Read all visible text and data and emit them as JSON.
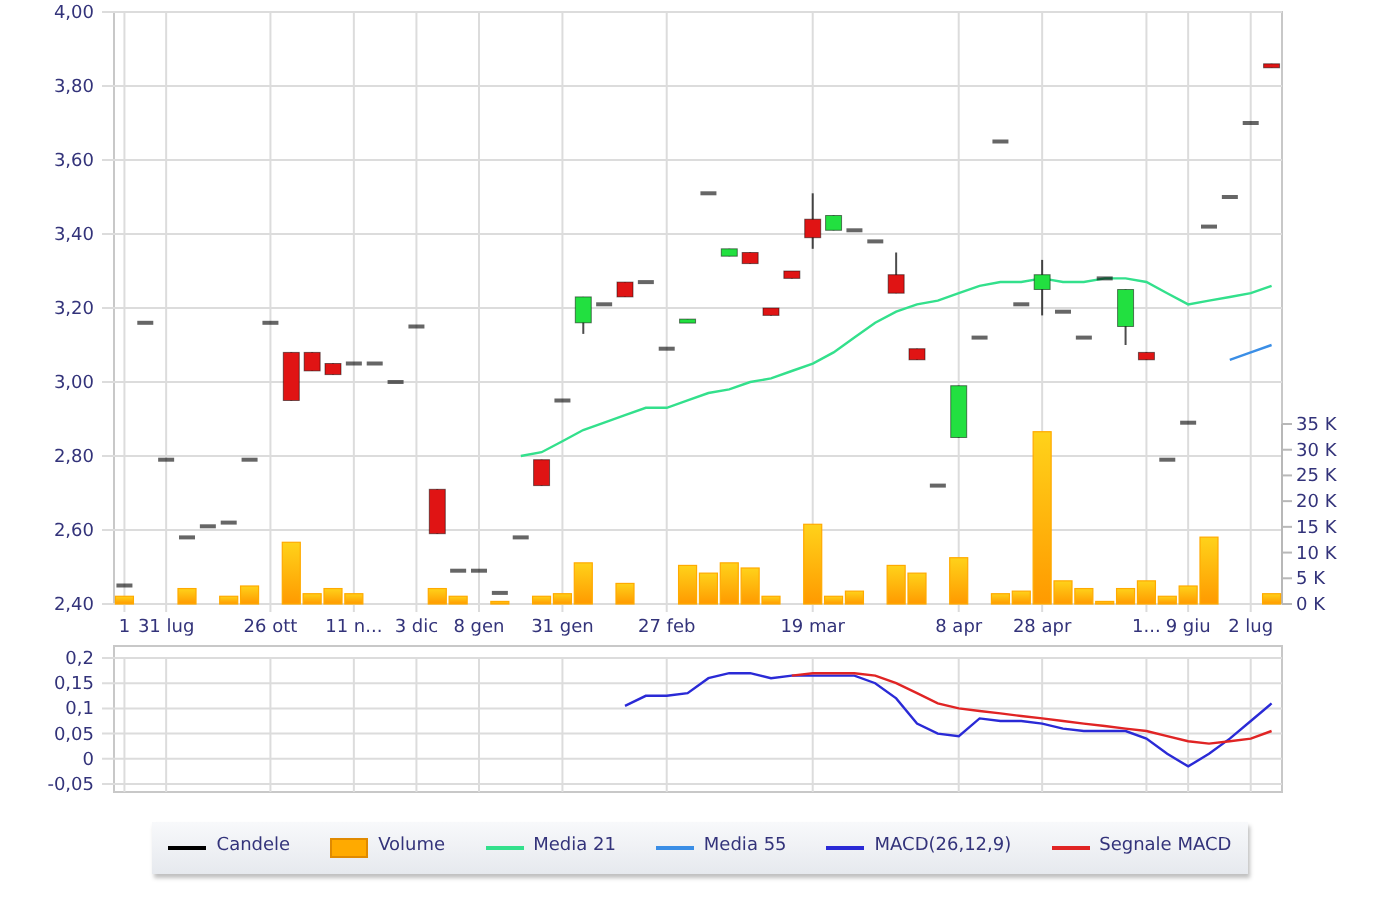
{
  "price_chart": {
    "chart_data": {
      "type": "bar",
      "grid": true,
      "ylim": [
        2.4,
        4.0
      ],
      "y2lim": [
        0,
        35
      ],
      "categories": [
        "1",
        null,
        "31 lug",
        null,
        null,
        null,
        null,
        "26 ott",
        null,
        null,
        null,
        "11 n...",
        null,
        null,
        "3 dic",
        null,
        null,
        "8 gen",
        null,
        null,
        null,
        "31 gen",
        null,
        null,
        null,
        null,
        "27 feb",
        null,
        null,
        null,
        null,
        null,
        null,
        "19 mar",
        null,
        null,
        null,
        null,
        null,
        null,
        "8 apr",
        null,
        null,
        null,
        "28 apr",
        null,
        null,
        null,
        null,
        "1...",
        null,
        "9 giu",
        null,
        null,
        "2 lug",
        null
      ],
      "yticks": [
        {
          "value": 2.4,
          "label": "2,40"
        },
        {
          "value": 2.6,
          "label": "2,60"
        },
        {
          "value": 2.8,
          "label": "2,80"
        },
        {
          "value": 3.0,
          "label": "3,00"
        },
        {
          "value": 3.2,
          "label": "3,20"
        },
        {
          "value": 3.4,
          "label": "3,40"
        },
        {
          "value": 3.6,
          "label": "3,60"
        },
        {
          "value": 3.8,
          "label": "3,80"
        },
        {
          "value": 4.0,
          "label": "4,00"
        }
      ],
      "y2ticks": [
        {
          "value": 0,
          "label": "0 K"
        },
        {
          "value": 5,
          "label": "5 K"
        },
        {
          "value": 10,
          "label": "10 K"
        },
        {
          "value": 15,
          "label": "15 K"
        },
        {
          "value": 20,
          "label": "20 K"
        },
        {
          "value": 25,
          "label": "25 K"
        },
        {
          "value": 30,
          "label": "30 K"
        },
        {
          "value": 35,
          "label": "35 K"
        }
      ],
      "series": [
        {
          "name": "Candele",
          "type": "candlestick",
          "color": "#000000",
          "ohlc": [
            [
              2.45,
              2.45,
              2.45,
              2.45
            ],
            [
              3.16,
              3.16,
              3.16,
              3.16
            ],
            [
              2.79,
              2.79,
              2.79,
              2.79
            ],
            [
              2.58,
              2.58,
              2.58,
              2.58
            ],
            [
              2.61,
              2.61,
              2.61,
              2.61
            ],
            [
              2.62,
              2.62,
              2.62,
              2.62
            ],
            [
              2.79,
              2.79,
              2.79,
              2.79
            ],
            [
              3.16,
              3.16,
              3.16,
              3.16
            ],
            [
              3.08,
              3.08,
              2.95,
              2.95
            ],
            [
              3.08,
              3.08,
              3.03,
              3.03
            ],
            [
              3.05,
              3.05,
              3.02,
              3.02
            ],
            [
              3.05,
              3.05,
              3.05,
              3.05
            ],
            [
              3.05,
              3.05,
              3.05,
              3.05
            ],
            [
              3.0,
              3.0,
              3.0,
              3.0
            ],
            [
              3.15,
              3.15,
              3.15,
              3.15
            ],
            [
              2.71,
              2.71,
              2.59,
              2.59
            ],
            [
              2.49,
              2.49,
              2.49,
              2.49
            ],
            [
              2.49,
              2.49,
              2.49,
              2.49
            ],
            [
              2.43,
              2.43,
              2.43,
              2.43
            ],
            [
              2.58,
              2.58,
              2.58,
              2.58
            ],
            [
              2.79,
              2.79,
              2.72,
              2.72
            ],
            [
              2.95,
              2.95,
              2.95,
              2.95
            ],
            [
              3.16,
              3.23,
              3.13,
              3.23
            ],
            [
              3.21,
              3.21,
              3.21,
              3.21
            ],
            [
              3.27,
              3.27,
              3.23,
              3.23
            ],
            [
              3.27,
              3.27,
              3.27,
              3.27
            ],
            [
              3.09,
              3.09,
              3.09,
              3.09
            ],
            [
              3.16,
              3.17,
              3.16,
              3.17
            ],
            [
              3.51,
              3.51,
              3.51,
              3.51
            ],
            [
              3.34,
              3.36,
              3.34,
              3.36
            ],
            [
              3.35,
              3.35,
              3.32,
              3.32
            ],
            [
              3.2,
              3.2,
              3.18,
              3.18
            ],
            [
              3.3,
              3.3,
              3.28,
              3.28
            ],
            [
              3.44,
              3.51,
              3.36,
              3.39
            ],
            [
              3.41,
              3.45,
              3.41,
              3.45
            ],
            [
              3.41,
              3.41,
              3.41,
              3.41
            ],
            [
              3.38,
              3.38,
              3.38,
              3.38
            ],
            [
              3.29,
              3.35,
              3.24,
              3.24
            ],
            [
              3.09,
              3.09,
              3.06,
              3.06
            ],
            [
              2.72,
              2.72,
              2.72,
              2.72
            ],
            [
              2.85,
              2.99,
              2.85,
              2.99
            ],
            [
              3.12,
              3.12,
              3.12,
              3.12
            ],
            [
              3.65,
              3.65,
              3.65,
              3.65
            ],
            [
              3.21,
              3.21,
              3.21,
              3.21
            ],
            [
              3.25,
              3.33,
              3.18,
              3.29
            ],
            [
              3.19,
              3.19,
              3.19,
              3.19
            ],
            [
              3.12,
              3.12,
              3.12,
              3.12
            ],
            [
              3.28,
              3.28,
              3.28,
              3.28
            ],
            [
              3.15,
              3.25,
              3.1,
              3.25
            ],
            [
              3.08,
              3.08,
              3.06,
              3.06
            ],
            [
              2.79,
              2.79,
              2.79,
              2.79
            ],
            [
              2.89,
              2.89,
              2.89,
              2.89
            ],
            [
              3.42,
              3.42,
              3.42,
              3.42
            ],
            [
              3.5,
              3.5,
              3.5,
              3.5
            ],
            [
              3.7,
              3.7,
              3.7,
              3.7
            ],
            [
              3.86,
              3.86,
              3.85,
              3.85
            ]
          ]
        },
        {
          "name": "Volume",
          "type": "bar",
          "axis": "y2",
          "color": "#ffaa00",
          "values": [
            1.5,
            0,
            0,
            3,
            0,
            1.5,
            3.5,
            0,
            12,
            2,
            3,
            2,
            0,
            0,
            0,
            3,
            1.5,
            0,
            0.5,
            0,
            1.5,
            2,
            8,
            0,
            4,
            0,
            0,
            7.5,
            6,
            8,
            7,
            1.5,
            0,
            15.5,
            1.5,
            2.5,
            0,
            7.5,
            6,
            0,
            9,
            0,
            2,
            2.5,
            33.5,
            4.5,
            3,
            0.5,
            3,
            4.5,
            1.5,
            3.5,
            13,
            0,
            0,
            2
          ]
        },
        {
          "name": "Media 21",
          "type": "line",
          "color": "#33e08c",
          "values": [
            null,
            null,
            null,
            null,
            null,
            null,
            null,
            null,
            null,
            null,
            null,
            null,
            null,
            null,
            null,
            null,
            null,
            null,
            null,
            2.8,
            2.81,
            2.84,
            2.87,
            2.89,
            2.91,
            2.93,
            2.93,
            2.95,
            2.97,
            2.98,
            3.0,
            3.01,
            3.03,
            3.05,
            3.08,
            3.12,
            3.16,
            3.19,
            3.21,
            3.22,
            3.24,
            3.26,
            3.27,
            3.27,
            3.28,
            3.27,
            3.27,
            3.28,
            3.28,
            3.27,
            3.24,
            3.21,
            3.22,
            3.23,
            3.24,
            3.26
          ]
        },
        {
          "name": "Media 55",
          "type": "line",
          "color": "#3a8ee6",
          "values": [
            null,
            null,
            null,
            null,
            null,
            null,
            null,
            null,
            null,
            null,
            null,
            null,
            null,
            null,
            null,
            null,
            null,
            null,
            null,
            null,
            null,
            null,
            null,
            null,
            null,
            null,
            null,
            null,
            null,
            null,
            null,
            null,
            null,
            null,
            null,
            null,
            null,
            null,
            null,
            null,
            null,
            null,
            null,
            null,
            null,
            null,
            null,
            null,
            null,
            null,
            null,
            null,
            null,
            3.06,
            3.08,
            3.1
          ]
        }
      ]
    }
  },
  "macd_chart": {
    "chart_data": {
      "type": "line",
      "grid": true,
      "ylim": [
        -0.05,
        0.2
      ],
      "categories": [
        null,
        null,
        null,
        null,
        null,
        null,
        null,
        null,
        null,
        null,
        null,
        null,
        null,
        null,
        null,
        null,
        null,
        null,
        null,
        null,
        null,
        null,
        null,
        null,
        null,
        null,
        null,
        null,
        null,
        null,
        null,
        null,
        null,
        null,
        null,
        null,
        null,
        null,
        null,
        null,
        null,
        null,
        null,
        null,
        null,
        null,
        null,
        null,
        null,
        null,
        null,
        null,
        null,
        null,
        null,
        null
      ],
      "yticks": [
        {
          "value": -0.05,
          "label": "-0,05"
        },
        {
          "value": 0,
          "label": "0"
        },
        {
          "value": 0.05,
          "label": "0,05"
        },
        {
          "value": 0.1,
          "label": "0,1"
        },
        {
          "value": 0.15,
          "label": "0,15"
        },
        {
          "value": 0.2,
          "label": "0,2"
        }
      ],
      "series": [
        {
          "name": "MACD(26,12,9)",
          "color": "#2a2ad6",
          "values": [
            null,
            null,
            null,
            null,
            null,
            null,
            null,
            null,
            null,
            null,
            null,
            null,
            null,
            null,
            null,
            null,
            null,
            null,
            null,
            null,
            null,
            null,
            null,
            null,
            0.105,
            0.125,
            0.125,
            0.13,
            0.16,
            0.17,
            0.17,
            0.16,
            0.165,
            0.165,
            0.165,
            0.165,
            0.15,
            0.12,
            0.07,
            0.05,
            0.045,
            0.08,
            0.075,
            0.075,
            0.07,
            0.06,
            0.055,
            0.055,
            0.055,
            0.04,
            0.01,
            -0.015,
            0.01,
            0.04,
            0.075,
            0.11
          ]
        },
        {
          "name": "Segnale MACD",
          "color": "#e02424",
          "values": [
            null,
            null,
            null,
            null,
            null,
            null,
            null,
            null,
            null,
            null,
            null,
            null,
            null,
            null,
            null,
            null,
            null,
            null,
            null,
            null,
            null,
            null,
            null,
            null,
            null,
            null,
            null,
            null,
            null,
            null,
            null,
            null,
            0.165,
            0.17,
            0.17,
            0.17,
            0.165,
            0.15,
            0.13,
            0.11,
            0.1,
            0.095,
            0.09,
            0.085,
            0.08,
            0.075,
            0.07,
            0.065,
            0.06,
            0.055,
            0.045,
            0.035,
            0.03,
            0.035,
            0.04,
            0.055
          ]
        }
      ]
    }
  }
}
